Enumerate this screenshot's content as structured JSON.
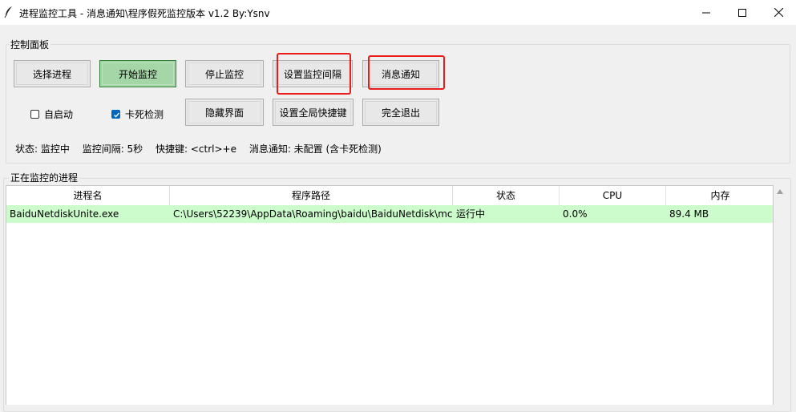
{
  "window": {
    "title": "进程监控工具 - 消息通知\\程序假死监控版本 v1.2    By:Ysnv",
    "minimize_icon": "minimize-icon",
    "maximize_icon": "maximize-icon",
    "close_icon": "close-icon"
  },
  "control_panel": {
    "label": "控制面板",
    "buttons": {
      "select_process": "选择进程",
      "start_monitor": "开始监控",
      "stop_monitor": "停止监控",
      "set_interval": "设置监控间隔",
      "notifications": "消息通知",
      "hide_ui": "隐藏界面",
      "set_hotkey": "设置全局快捷键",
      "quit": "完全退出"
    },
    "checkboxes": {
      "autostart": {
        "label": "自启动",
        "checked": false
      },
      "hang_detect": {
        "label": "卡死检测",
        "checked": true
      }
    },
    "status": {
      "state": "状态: 监控中",
      "interval": "监控间隔: 5秒",
      "hotkey": "快捷键: <ctrl>+e",
      "notify": "消息通知: 未配置 (含卡死检测)"
    },
    "accent_color": "#a5d6a7",
    "highlight_color": "#ea1d1d"
  },
  "process_list": {
    "label": "正在监控的进程",
    "columns": [
      "进程名",
      "程序路径",
      "状态",
      "CPU",
      "内存"
    ],
    "rows": [
      {
        "name": "BaiduNetdiskUnite.exe",
        "path": "C:\\Users\\52239\\AppData\\Roaming\\baidu\\BaiduNetdisk\\mc",
        "status": "运行中",
        "cpu": "0.0%",
        "memory": "89.4 MB"
      }
    ],
    "row_color": "#ccfccc"
  }
}
